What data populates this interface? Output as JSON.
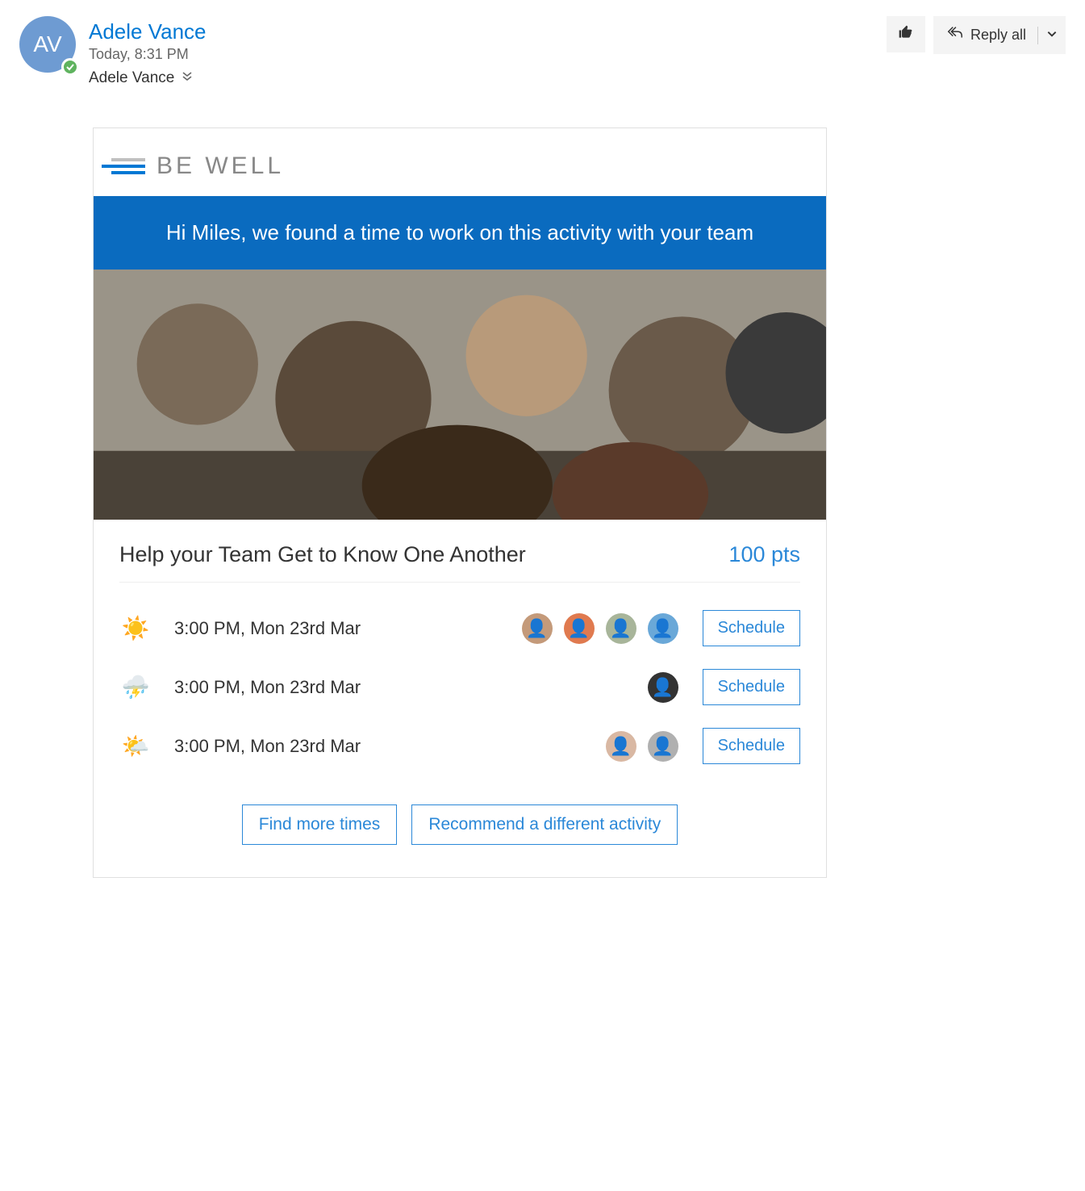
{
  "header": {
    "avatar_initials": "AV",
    "sender_name": "Adele Vance",
    "timestamp": "Today, 8:31 PM",
    "recipient": "Adele Vance",
    "reply_all_label": "Reply all"
  },
  "card": {
    "brand": "BE WELL",
    "banner_text": "Hi Miles, we found a time to work on this activity with your team",
    "activity_title": "Help your Team Get to Know One Another",
    "activity_points": "100 pts",
    "slots": [
      {
        "weather_icon": "sunny",
        "time": "3:00 PM, Mon 23rd Mar",
        "attendee_count": 4,
        "schedule_label": "Schedule"
      },
      {
        "weather_icon": "storm",
        "time": "3:00 PM, Mon 23rd Mar",
        "attendee_count": 1,
        "schedule_label": "Schedule"
      },
      {
        "weather_icon": "partly-cloudy",
        "time": "3:00 PM, Mon 23rd Mar",
        "attendee_count": 2,
        "schedule_label": "Schedule"
      }
    ],
    "footer": {
      "find_more_label": "Find more times",
      "recommend_label": "Recommend a different activity"
    }
  },
  "attendee_colors": [
    "#c49a7a",
    "#e07a4f",
    "#a8b59a",
    "#6aa8d8",
    "#333333",
    "#d9b8a3",
    "#b0b0b0"
  ]
}
